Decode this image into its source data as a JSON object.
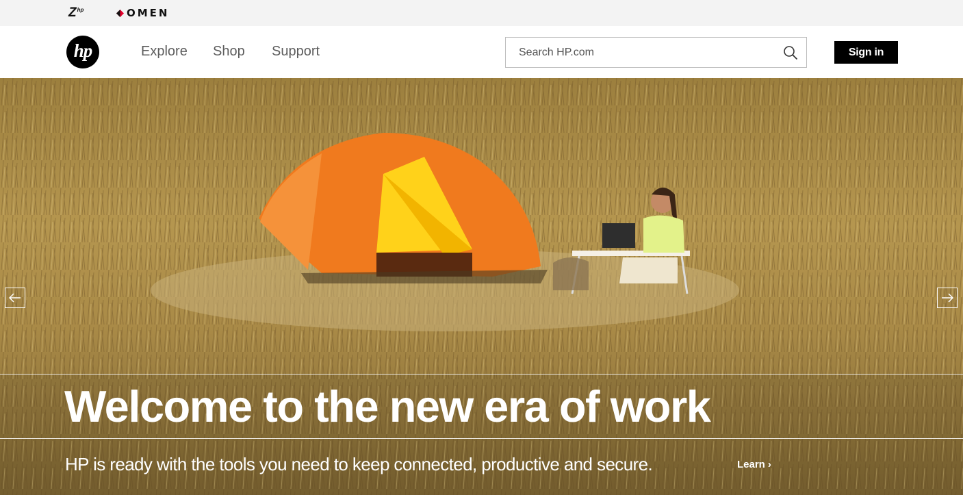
{
  "brands": {
    "z_logo_text": "Z",
    "z_logo_sub": "hp",
    "omen_logo_text": "OMEN"
  },
  "header": {
    "logo_text": "hp",
    "nav": [
      {
        "label": "Explore"
      },
      {
        "label": "Shop"
      },
      {
        "label": "Support"
      }
    ],
    "search": {
      "placeholder": "Search HP.com",
      "icon": "search-icon"
    },
    "signin_label": "Sign in"
  },
  "hero": {
    "title": "Welcome to the new era of work",
    "subtitle": "HP is ready with the tools you need to keep connected, productive and secure.",
    "learn_label": "Learn",
    "learn_icon": "chevron-right-icon",
    "prev_icon": "arrow-left-icon",
    "next_icon": "arrow-right-icon"
  },
  "colors": {
    "brand_strip": "#f3f3f3",
    "signin_bg": "#000000",
    "omen_red": "#e4002b",
    "hero_grass": "#a98b45",
    "tent_orange": "#f07a1e"
  }
}
